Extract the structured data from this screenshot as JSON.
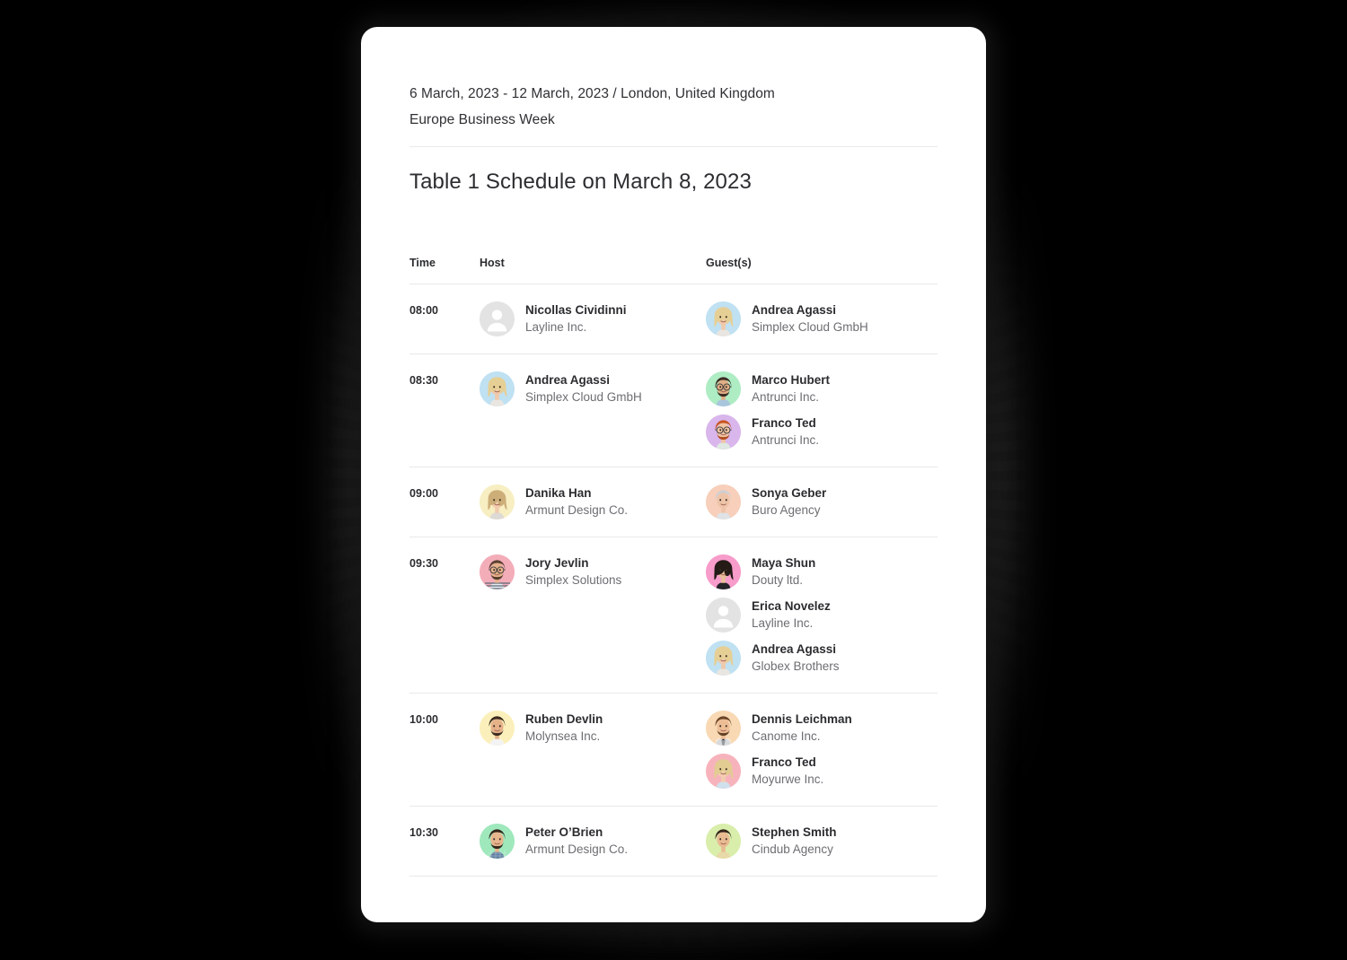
{
  "card": {
    "meta": {
      "dates_location": "6 March, 2023 - 12 March, 2023 / London, United Kingdom",
      "event_name": "Europe Business Week"
    },
    "title": "Table 1 Schedule on March 8, 2023"
  },
  "table": {
    "columns": {
      "time": "Time",
      "host": "Host",
      "guests": "Guest(s)"
    },
    "rows": [
      {
        "time": "08:00",
        "host": {
          "name": "Nicollas Cividinni",
          "org": "Layline Inc.",
          "avatar": "placeholder-avatar",
          "bg": "#e3e3e3"
        },
        "guests": [
          {
            "name": "Andrea Agassi",
            "org": "Simplex Cloud GmbH",
            "avatar": "photo-avatar-blonde-woman",
            "bg": "#bfe1f2"
          }
        ]
      },
      {
        "time": "08:30",
        "host": {
          "name": "Andrea Agassi",
          "org": "Simplex Cloud GmbH",
          "avatar": "photo-avatar-blonde-woman",
          "bg": "#bfe1f2"
        },
        "guests": [
          {
            "name": "Marco Hubert",
            "org": "Antrunci Inc.",
            "avatar": "photo-avatar-man-glasses-beard",
            "bg": "#aeecc4"
          },
          {
            "name": "Franco Ted",
            "org": "Antrunci Inc.",
            "avatar": "photo-avatar-redhead-glasses",
            "bg": "#d9b6ec"
          }
        ]
      },
      {
        "time": "09:00",
        "host": {
          "name": "Danika Han",
          "org": "Armunt Design Co.",
          "avatar": "photo-avatar-smiling-woman",
          "bg": "#f7eec2"
        },
        "guests": [
          {
            "name": "Sonya Geber",
            "org": "Buro Agency",
            "avatar": "photo-avatar-silver-hair-woman",
            "bg": "#f7cfbb"
          }
        ]
      },
      {
        "time": "09:30",
        "host": {
          "name": "Jory Jevlin",
          "org": "Simplex Solutions",
          "avatar": "photo-avatar-bearded-man-stripes",
          "bg": "#f3adb9"
        },
        "guests": [
          {
            "name": "Maya Shun",
            "org": "Douty ltd.",
            "avatar": "photo-avatar-dark-hair-woman",
            "bg": "#f79ccb"
          },
          {
            "name": "Erica Novelez",
            "org": "Layline Inc.",
            "avatar": "placeholder-avatar",
            "bg": "#e3e3e3"
          },
          {
            "name": "Andrea Agassi",
            "org": "Globex Brothers",
            "avatar": "photo-avatar-blonde-woman",
            "bg": "#bfe1f2"
          }
        ]
      },
      {
        "time": "10:00",
        "host": {
          "name": "Ruben Devlin",
          "org": "Molynsea Inc.",
          "avatar": "photo-avatar-dark-hair-beard-man",
          "bg": "#fbf0bb"
        },
        "guests": [
          {
            "name": "Dennis Leichman",
            "org": "Canome Inc.",
            "avatar": "photo-avatar-suit-beard-man",
            "bg": "#f8d9b4"
          },
          {
            "name": "Franco Ted",
            "org": "Moyurwe Inc.",
            "avatar": "photo-avatar-blonde-woman-pink",
            "bg": "#f7b3bc"
          }
        ]
      },
      {
        "time": "10:30",
        "host": {
          "name": "Peter O’Brien",
          "org": "Armunt Design Co.",
          "avatar": "photo-avatar-plaid-shirt-man",
          "bg": "#9fe8bc"
        },
        "guests": [
          {
            "name": "Stephen Smith",
            "org": "Cindub Agency",
            "avatar": "photo-avatar-smiling-man",
            "bg": "#d9eeab"
          }
        ]
      }
    ]
  },
  "colors": {
    "page_background": "#000000",
    "card_background": "#ffffff",
    "text_primary": "#2b2c2f",
    "text_secondary": "#6d6e72",
    "divider": "#e9e9ea"
  }
}
